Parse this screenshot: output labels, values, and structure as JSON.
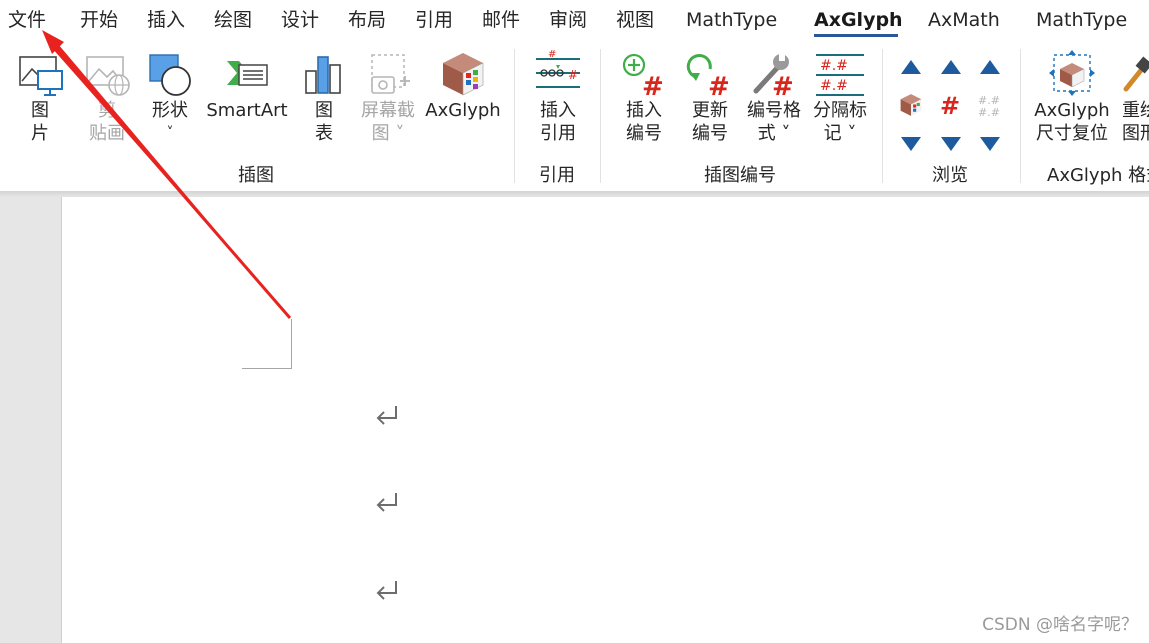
{
  "menu": {
    "items": [
      "文件",
      "开始",
      "插入",
      "绘图",
      "设计",
      "布局",
      "引用",
      "邮件",
      "审阅",
      "视图",
      "MathType",
      "AxGlyph",
      "AxMath",
      "MathType"
    ],
    "active_index": 11
  },
  "ribbon": {
    "groups": {
      "illustrations": "插图",
      "citation": "引用",
      "caption": "插图编号",
      "browse": "浏览",
      "axglyph_format": "AxGlyph 格式"
    },
    "buttons": {
      "picture": [
        "图",
        "片"
      ],
      "clipart": [
        "剪",
        "贴画"
      ],
      "shapes": [
        "形状",
        "˅"
      ],
      "smartart": "SmartArt",
      "chart": [
        "图",
        "表"
      ],
      "screenshot": [
        "屏幕截",
        "图 ˅"
      ],
      "axglyph": "AxGlyph",
      "insert_citation": [
        "插入",
        "引用"
      ],
      "insert_number": [
        "插入",
        "编号"
      ],
      "update_number": [
        "更新",
        "编号"
      ],
      "number_format": [
        "编号格",
        "式 ˅"
      ],
      "separator_mark": [
        "分隔标",
        "记 ˅"
      ],
      "size_reset": [
        "AxGlyph",
        "尺寸复位"
      ],
      "redraw": [
        "重绘",
        "图形"
      ]
    }
  },
  "document": {
    "paragraph_mark": "↵"
  },
  "watermark": "CSDN @啥名字呢？",
  "colors": {
    "accent": "#2b579a",
    "annotation_arrow": "#e8231f",
    "nav_arrow": "#1e5a9e",
    "number_red": "#d9251c"
  }
}
